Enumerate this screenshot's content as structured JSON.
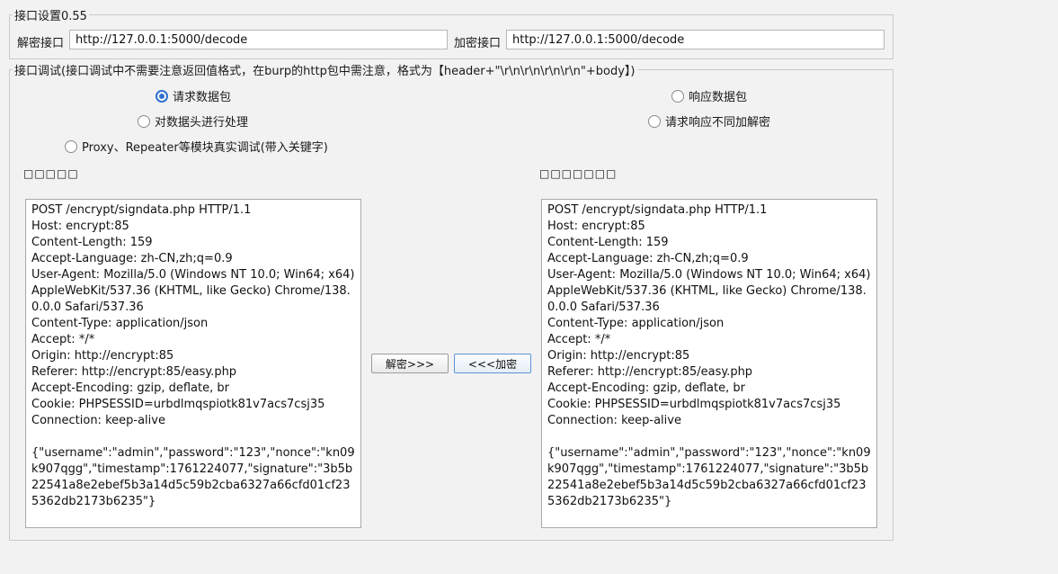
{
  "api_settings": {
    "legend": "接口设置0.55",
    "decode_label": "解密接口",
    "decode_url": "http://127.0.0.1:5000/decode",
    "encode_label": "加密接口",
    "encode_url": "http://127.0.0.1:5000/decode"
  },
  "debug": {
    "legend": "接口调试(接口调试中不需要注意返回值格式，在burp的http包中需注意，格式为【header+\"\\r\\n\\r\\n\\r\\n\\r\\n\"+body】)",
    "radio_request": "请求数据包",
    "radio_response": "响应数据包",
    "radio_header": "对数据头进行处理",
    "radio_no_decrypt": "请求响应不同加解密",
    "radio_proxy": "Proxy、Repeater等模块真实调试(带入关键字)",
    "left_title": "□□□□□",
    "right_title": "□□□□□□□",
    "decrypt_button": "解密>>>",
    "encrypt_button": "<<<加密",
    "left_text": "POST /encrypt/signdata.php HTTP/1.1\nHost: encrypt:85\nContent-Length: 159\nAccept-Language: zh-CN,zh;q=0.9\nUser-Agent: Mozilla/5.0 (Windows NT 10.0; Win64; x64) AppleWebKit/537.36 (KHTML, like Gecko) Chrome/138.0.0.0 Safari/537.36\nContent-Type: application/json\nAccept: */*\nOrigin: http://encrypt:85\nReferer: http://encrypt:85/easy.php\nAccept-Encoding: gzip, deflate, br\nCookie: PHPSESSID=urbdlmqspiotk81v7acs7csj35\nConnection: keep-alive\n\n{\"username\":\"admin\",\"password\":\"123\",\"nonce\":\"kn09k907qgg\",\"timestamp\":1761224077,\"signature\":\"3b5b22541a8e2ebef5b3a14d5c59b2cba6327a66cfd01cf235362db2173b6235\"}",
    "right_text": "POST /encrypt/signdata.php HTTP/1.1\nHost: encrypt:85\nContent-Length: 159\nAccept-Language: zh-CN,zh;q=0.9\nUser-Agent: Mozilla/5.0 (Windows NT 10.0; Win64; x64) AppleWebKit/537.36 (KHTML, like Gecko) Chrome/138.0.0.0 Safari/537.36\nContent-Type: application/json\nAccept: */*\nOrigin: http://encrypt:85\nReferer: http://encrypt:85/easy.php\nAccept-Encoding: gzip, deflate, br\nCookie: PHPSESSID=urbdlmqspiotk81v7acs7csj35\nConnection: keep-alive\n\n{\"username\":\"admin\",\"password\":\"123\",\"nonce\":\"kn09k907qgg\",\"timestamp\":1761224077,\"signature\":\"3b5b22541a8e2ebef5b3a14d5c59b2cba6327a66cfd01cf235362db2173b6235\"}"
  },
  "colors": {
    "accent": "#2f6fd1",
    "background": "#f2f2f2"
  }
}
